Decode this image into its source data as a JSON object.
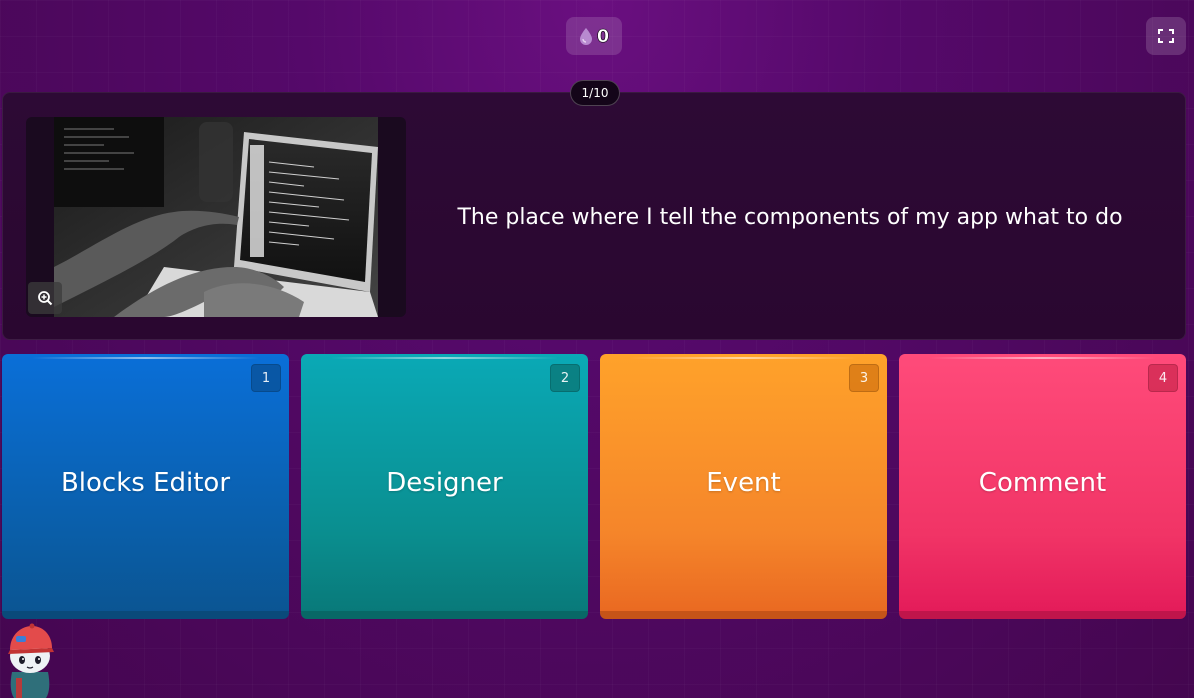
{
  "header": {
    "score": "0",
    "score_icon": "drop-icon",
    "fullscreen_icon": "expand-icon"
  },
  "question": {
    "counter": "1/10",
    "text": "The place where I tell the components of my app what to do",
    "image_alt": "Hands pointing at code on a laptop screen",
    "zoom_icon": "zoom-in-icon"
  },
  "options": [
    {
      "number": "1",
      "label": "Blocks Editor",
      "color": "#0a6fd8"
    },
    {
      "number": "2",
      "label": "Designer",
      "color": "#0aa9b6"
    },
    {
      "number": "3",
      "label": "Event",
      "color": "#ffa22a"
    },
    {
      "number": "4",
      "label": "Comment",
      "color": "#ff4b7a"
    }
  ],
  "colors": {
    "background": "#55096a",
    "card": "#2d0a35"
  }
}
